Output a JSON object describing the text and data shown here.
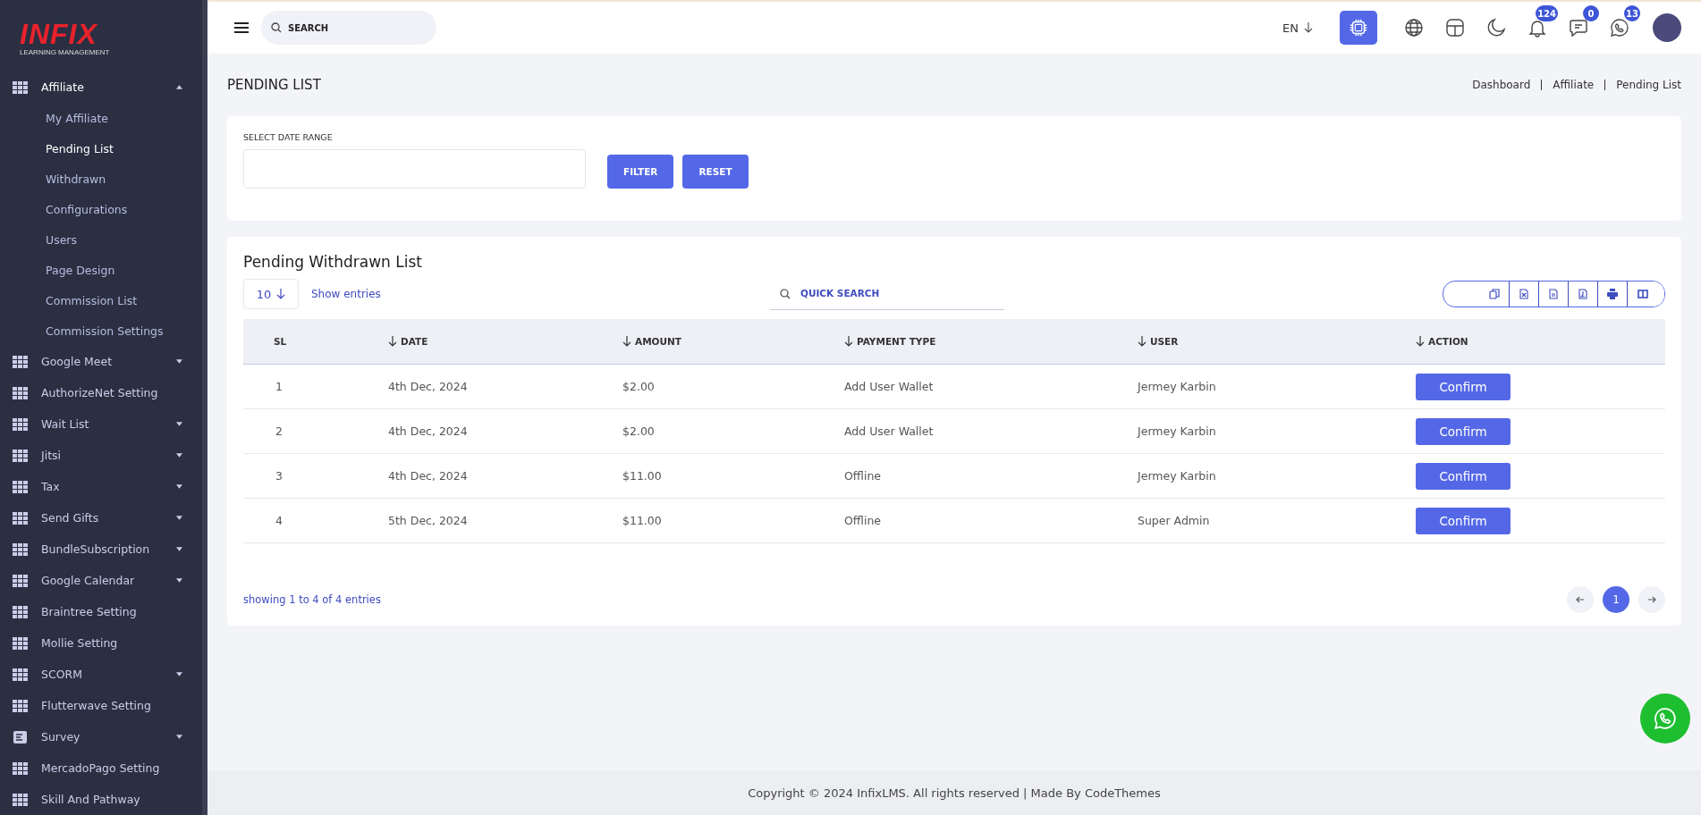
{
  "sidebar": {
    "logo": {
      "title": "INFIX",
      "subtitle": "LEARNING MANAGEMENT"
    },
    "items": [
      {
        "label": "Affiliate",
        "kind": "grid",
        "submenu": true,
        "expanded": true,
        "children": [
          {
            "label": "My Affiliate",
            "selected": false
          },
          {
            "label": "Pending List",
            "selected": true
          },
          {
            "label": "Withdrawn",
            "selected": false
          },
          {
            "label": "Configurations",
            "selected": false
          },
          {
            "label": "Users",
            "selected": false
          },
          {
            "label": "Page Design",
            "selected": false
          },
          {
            "label": "Commission List",
            "selected": false
          },
          {
            "label": "Commission Settings",
            "selected": false
          }
        ]
      },
      {
        "label": "Google Meet",
        "kind": "grid",
        "submenu": true,
        "expanded": false
      },
      {
        "label": "AuthorizeNet Setting",
        "kind": "grid",
        "submenu": false,
        "expanded": false
      },
      {
        "label": "Wait List",
        "kind": "grid",
        "submenu": true,
        "expanded": false
      },
      {
        "label": "Jitsi",
        "kind": "grid",
        "submenu": true,
        "expanded": false
      },
      {
        "label": "Tax",
        "kind": "grid",
        "submenu": true,
        "expanded": false
      },
      {
        "label": "Send Gifts",
        "kind": "grid",
        "submenu": true,
        "expanded": false
      },
      {
        "label": "BundleSubscription",
        "kind": "grid",
        "submenu": true,
        "expanded": false
      },
      {
        "label": "Google Calendar",
        "kind": "grid",
        "submenu": true,
        "expanded": false
      },
      {
        "label": "Braintree Setting",
        "kind": "grid",
        "submenu": false,
        "expanded": false
      },
      {
        "label": "Mollie Setting",
        "kind": "grid",
        "submenu": false,
        "expanded": false
      },
      {
        "label": "SCORM",
        "kind": "grid",
        "submenu": true,
        "expanded": false
      },
      {
        "label": "Flutterwave Setting",
        "kind": "grid",
        "submenu": false,
        "expanded": false
      },
      {
        "label": "Survey",
        "kind": "form",
        "submenu": true,
        "expanded": false
      },
      {
        "label": "MercadoPago Setting",
        "kind": "grid",
        "submenu": false,
        "expanded": false
      },
      {
        "label": "Skill And Pathway",
        "kind": "grid",
        "submenu": false,
        "expanded": false
      }
    ]
  },
  "topbar": {
    "search": {
      "placeholder": "SEARCH"
    },
    "language": "EN",
    "icons": [
      {
        "kind": "ai"
      },
      {
        "kind": "globe"
      },
      {
        "kind": "layout"
      },
      {
        "kind": "moon"
      },
      {
        "kind": "bell",
        "badge": "124"
      },
      {
        "kind": "chat",
        "badge": "0"
      },
      {
        "kind": "whatsapp",
        "badge": "13"
      },
      {
        "kind": "avatar"
      }
    ]
  },
  "page": {
    "title": "PENDING LIST",
    "breadcrumbs": [
      "Dashboard",
      "Affiliate",
      "Pending List"
    ]
  },
  "filter": {
    "label": "SELECT DATE RANGE",
    "buttons": [
      "FILTER",
      "RESET"
    ]
  },
  "table": {
    "title": "Pending Withdrawn List",
    "page_size": "10",
    "show_entries": "Show entries",
    "search": {
      "placeholder": "QUICK SEARCH"
    },
    "exports": [
      {
        "kind": "copy"
      },
      {
        "kind": "excel"
      },
      {
        "kind": "csv"
      },
      {
        "kind": "pdf"
      },
      {
        "kind": "print"
      },
      {
        "kind": "columns"
      }
    ],
    "columns": [
      {
        "label": "SL",
        "sortable": false
      },
      {
        "label": "DATE",
        "sortable": true
      },
      {
        "label": "AMOUNT",
        "sortable": true
      },
      {
        "label": "PAYMENT TYPE",
        "sortable": true
      },
      {
        "label": "USER",
        "sortable": true
      },
      {
        "label": "ACTION",
        "sortable": true
      }
    ],
    "rows": [
      {
        "sl": "1",
        "date": "4th Dec, 2024",
        "amount": "$2.00",
        "payment_type": "Add User Wallet",
        "user": "Jermey Karbin",
        "action": "Confirm"
      },
      {
        "sl": "2",
        "date": "4th Dec, 2024",
        "amount": "$2.00",
        "payment_type": "Add User Wallet",
        "user": "Jermey Karbin",
        "action": "Confirm"
      },
      {
        "sl": "3",
        "date": "4th Dec, 2024",
        "amount": "$11.00",
        "payment_type": "Offline",
        "user": "Jermey Karbin",
        "action": "Confirm"
      },
      {
        "sl": "4",
        "date": "5th Dec, 2024",
        "amount": "$11.00",
        "payment_type": "Offline",
        "user": "Super Admin",
        "action": "Confirm"
      }
    ],
    "info": "showing 1 to 4 of 4 entries",
    "pages": [
      {
        "label": "1",
        "selected": true
      }
    ]
  },
  "footer": "Copyright © 2024 InfixLMS. All rights reserved | Made By CodeThemes"
}
